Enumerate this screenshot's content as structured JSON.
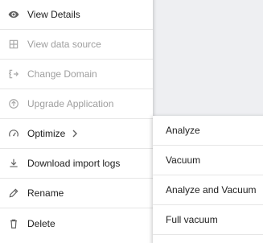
{
  "menu": {
    "items": [
      {
        "label": "View Details",
        "icon": "eye-icon",
        "enabled": true
      },
      {
        "label": "View data source",
        "icon": "table-grid-icon",
        "enabled": false
      },
      {
        "label": "Change Domain",
        "icon": "swap-domain-icon",
        "enabled": false
      },
      {
        "label": "Upgrade Application",
        "icon": "upgrade-arrow-circle-icon",
        "enabled": false
      },
      {
        "label": "Optimize",
        "icon": "speedometer-icon",
        "enabled": true,
        "has_submenu": true
      },
      {
        "label": "Download import logs",
        "icon": "download-icon",
        "enabled": true
      },
      {
        "label": "Rename",
        "icon": "pencil-icon",
        "enabled": true
      },
      {
        "label": "Delete",
        "icon": "trash-icon",
        "enabled": true
      }
    ]
  },
  "submenu": {
    "items": [
      {
        "label": "Analyze"
      },
      {
        "label": "Vacuum"
      },
      {
        "label": "Analyze and Vacuum"
      },
      {
        "label": "Full vacuum"
      }
    ]
  },
  "colors": {
    "text": "#212121",
    "disabled_text": "#9e9e9e",
    "divider": "#e6e6e6",
    "background": "#eeeff2",
    "menu_background": "#ffffff"
  }
}
